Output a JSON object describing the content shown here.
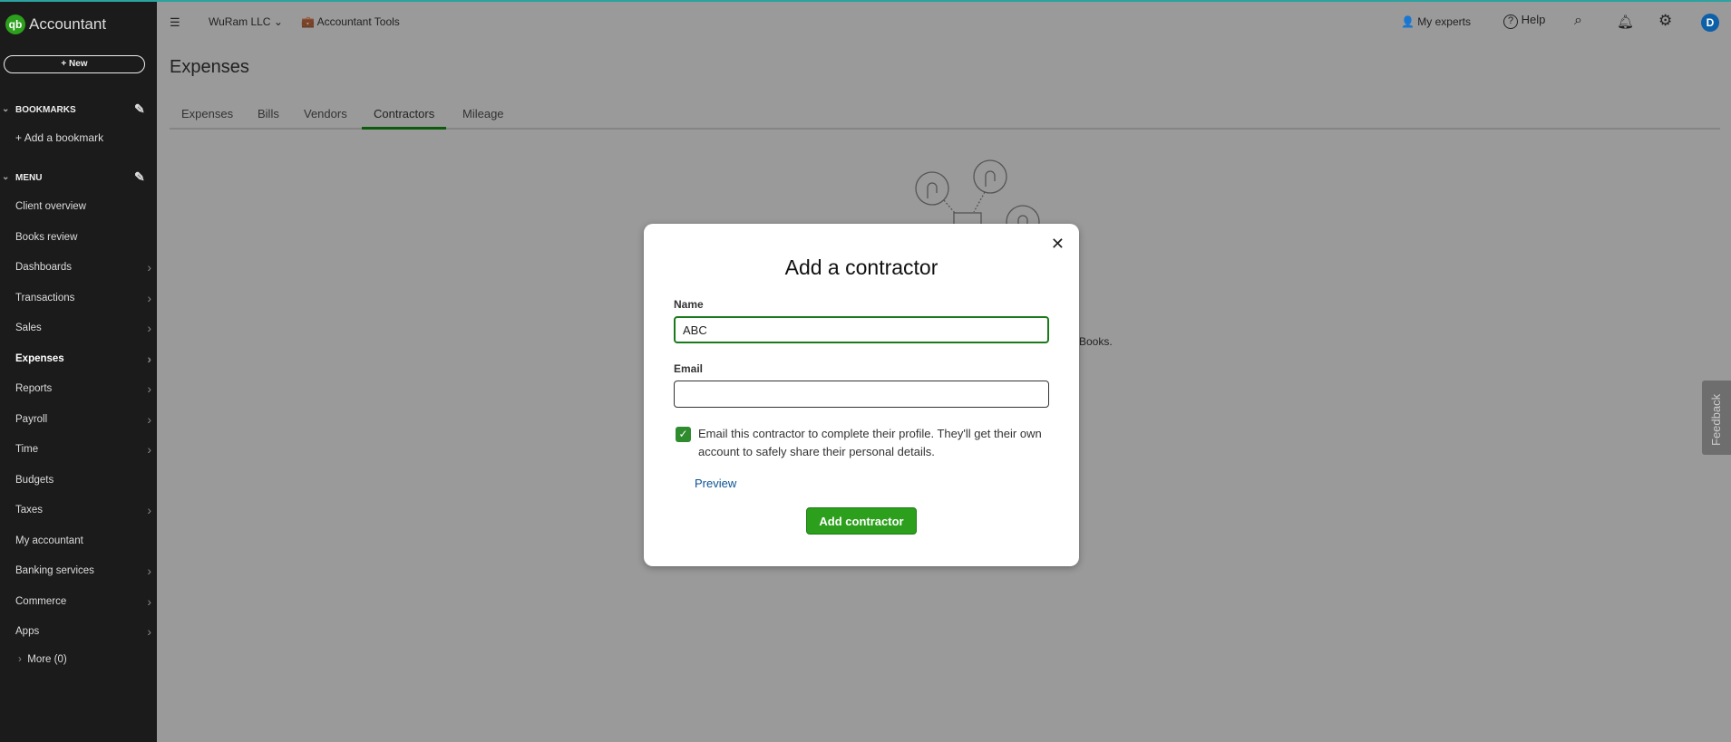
{
  "app": {
    "name": "Accountant",
    "logo": "qb",
    "new_label": "+ New"
  },
  "sidebar": {
    "bookmarks_label": "BOOKMARKS",
    "add_bookmark": "Add a bookmark",
    "menu_label": "MENU",
    "items": [
      {
        "label": "Client overview",
        "arrow": false
      },
      {
        "label": "Books review",
        "arrow": false
      },
      {
        "label": "Dashboards",
        "arrow": true
      },
      {
        "label": "Transactions",
        "arrow": true
      },
      {
        "label": "Sales",
        "arrow": true
      },
      {
        "label": "Expenses",
        "arrow": true,
        "active": true
      },
      {
        "label": "Reports",
        "arrow": true
      },
      {
        "label": "Payroll",
        "arrow": true
      },
      {
        "label": "Time",
        "arrow": true
      },
      {
        "label": "Budgets",
        "arrow": false
      },
      {
        "label": "Taxes",
        "arrow": true
      },
      {
        "label": "My accountant",
        "arrow": false
      },
      {
        "label": "Banking services",
        "arrow": true
      },
      {
        "label": "Commerce",
        "arrow": true
      },
      {
        "label": "Apps",
        "arrow": true
      }
    ],
    "more": "More (0)"
  },
  "topbar": {
    "company": "WuRam LLC",
    "tools": "Accountant Tools",
    "experts": "My experts",
    "help": "Help",
    "avatar": "D"
  },
  "page": {
    "title": "Expenses",
    "tabs": [
      "Expenses",
      "Bills",
      "Vendors",
      "Contractors",
      "Mileage"
    ],
    "active_tab": "Contractors",
    "bg_text": "Books."
  },
  "feedback": "Feedback",
  "dialog": {
    "title": "Add a contractor",
    "name_label": "Name",
    "name_value": "ABC",
    "email_label": "Email",
    "email_value": "",
    "checkbox_checked": true,
    "checkbox_text": "Email this contractor to complete their profile. They'll get their own account to safely share their personal details.",
    "preview": "Preview",
    "submit": "Add contractor"
  },
  "colors": {
    "accent": "#2ca01c",
    "sidebar": "#1b1b1b",
    "link": "#0b5394",
    "avatar": "#0d5fa8"
  }
}
